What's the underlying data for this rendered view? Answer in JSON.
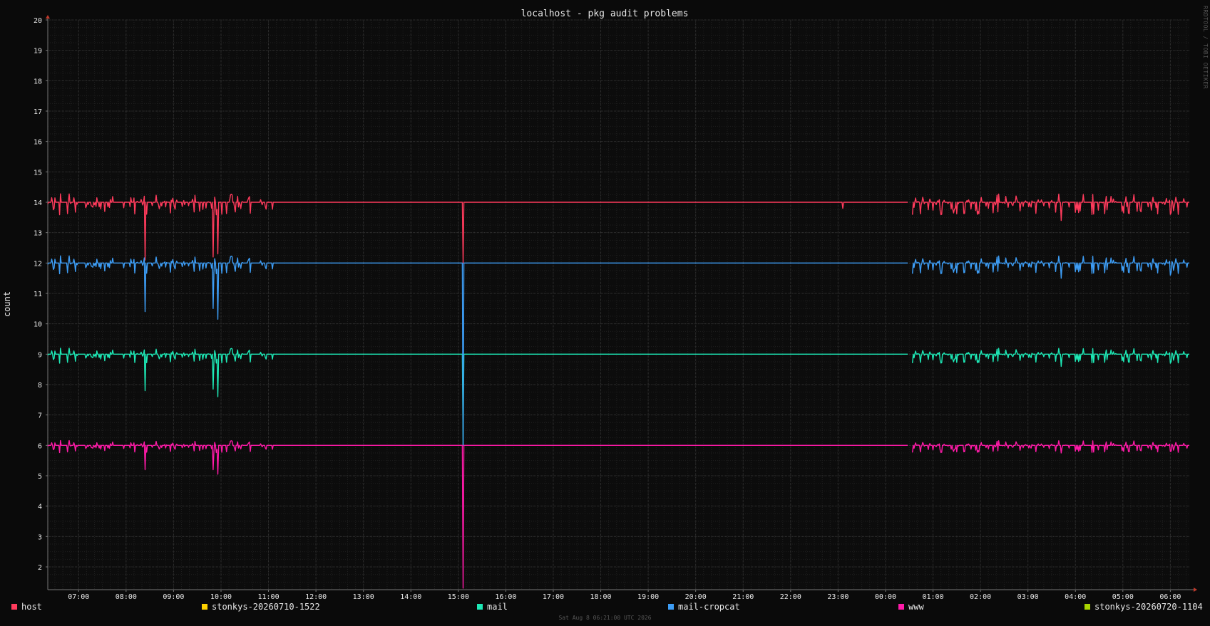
{
  "chart_data": {
    "type": "line",
    "title": "localhost - pkg audit problems",
    "ylabel": "count",
    "xlabel": "",
    "ylim": [
      1.25,
      20
    ],
    "y_ticks": [
      2,
      3,
      4,
      5,
      6,
      7,
      8,
      9,
      10,
      11,
      12,
      13,
      14,
      15,
      16,
      17,
      18,
      19,
      20
    ],
    "x_range_hours": [
      6.35,
      30.4
    ],
    "x_ticks": [
      {
        "h": 7,
        "label": "07:00"
      },
      {
        "h": 8,
        "label": "08:00"
      },
      {
        "h": 9,
        "label": "09:00"
      },
      {
        "h": 10,
        "label": "10:00"
      },
      {
        "h": 11,
        "label": "11:00"
      },
      {
        "h": 12,
        "label": "12:00"
      },
      {
        "h": 13,
        "label": "13:00"
      },
      {
        "h": 14,
        "label": "14:00"
      },
      {
        "h": 15,
        "label": "15:00"
      },
      {
        "h": 16,
        "label": "16:00"
      },
      {
        "h": 17,
        "label": "17:00"
      },
      {
        "h": 18,
        "label": "18:00"
      },
      {
        "h": 19,
        "label": "19:00"
      },
      {
        "h": 20,
        "label": "20:00"
      },
      {
        "h": 21,
        "label": "21:00"
      },
      {
        "h": 22,
        "label": "22:00"
      },
      {
        "h": 23,
        "label": "23:00"
      },
      {
        "h": 24,
        "label": "00:00"
      },
      {
        "h": 25,
        "label": "01:00"
      },
      {
        "h": 26,
        "label": "02:00"
      },
      {
        "h": 27,
        "label": "03:00"
      },
      {
        "h": 28,
        "label": "04:00"
      },
      {
        "h": 29,
        "label": "05:00"
      },
      {
        "h": 30,
        "label": "06:00"
      }
    ],
    "grid": true,
    "legend_position": "bottom",
    "gaps_hours": [
      [
        24.47,
        24.55
      ]
    ],
    "series": [
      {
        "name": "host",
        "color": "#ff3b5c",
        "baseline": 14,
        "noisy_ranges": [
          [
            6.35,
            11.1
          ],
          [
            24.5,
            30.35
          ]
        ],
        "noise_amp": 0.35,
        "dips": [
          [
            8.4,
            12.1
          ],
          [
            9.83,
            12.2
          ],
          [
            9.93,
            12.3
          ],
          [
            15.1,
            12.0
          ],
          [
            23.1,
            13.8
          ],
          [
            24.55,
            13.5
          ],
          [
            27.7,
            13.4
          ],
          [
            30.0,
            13.6
          ]
        ]
      },
      {
        "name": "stonkys-20260710-1522",
        "color": "#ffd200",
        "baseline": null
      },
      {
        "name": "mail",
        "color": "#1de9b6",
        "baseline": 9,
        "noisy_ranges": [
          [
            6.35,
            11.1
          ],
          [
            24.5,
            30.35
          ]
        ],
        "noise_amp": 0.25,
        "dips": [
          [
            8.4,
            7.8
          ],
          [
            9.83,
            7.85
          ],
          [
            9.93,
            7.6
          ],
          [
            15.1,
            6.0
          ],
          [
            24.55,
            8.7
          ],
          [
            27.7,
            8.6
          ],
          [
            30.0,
            8.7
          ]
        ]
      },
      {
        "name": "mail-cropcat",
        "color": "#3d9df5",
        "baseline": 12,
        "noisy_ranges": [
          [
            6.35,
            11.1
          ],
          [
            24.5,
            30.35
          ]
        ],
        "noise_amp": 0.3,
        "dips": [
          [
            8.4,
            10.4
          ],
          [
            9.83,
            10.5
          ],
          [
            9.93,
            10.15
          ],
          [
            15.1,
            6.0
          ],
          [
            24.55,
            11.6
          ],
          [
            27.7,
            11.5
          ],
          [
            30.0,
            11.6
          ]
        ]
      },
      {
        "name": "www",
        "color": "#ff1aa8",
        "baseline": 6,
        "noisy_ranges": [
          [
            6.35,
            11.1
          ],
          [
            24.5,
            30.35
          ]
        ],
        "noise_amp": 0.2,
        "dips": [
          [
            8.4,
            5.2
          ],
          [
            9.83,
            5.2
          ],
          [
            9.93,
            5.05
          ],
          [
            15.1,
            1.3
          ],
          [
            24.55,
            5.8
          ],
          [
            27.7,
            5.75
          ],
          [
            30.0,
            5.8
          ]
        ]
      },
      {
        "name": "stonkys-20260720-1104",
        "color": "#a8d400",
        "baseline": null
      }
    ]
  },
  "footer": {
    "timestamp": "Sat Aug  8 06:21:00 UTC 2026"
  },
  "watermark": {
    "text": "RRDTOOL / TOBI OETIKER"
  }
}
